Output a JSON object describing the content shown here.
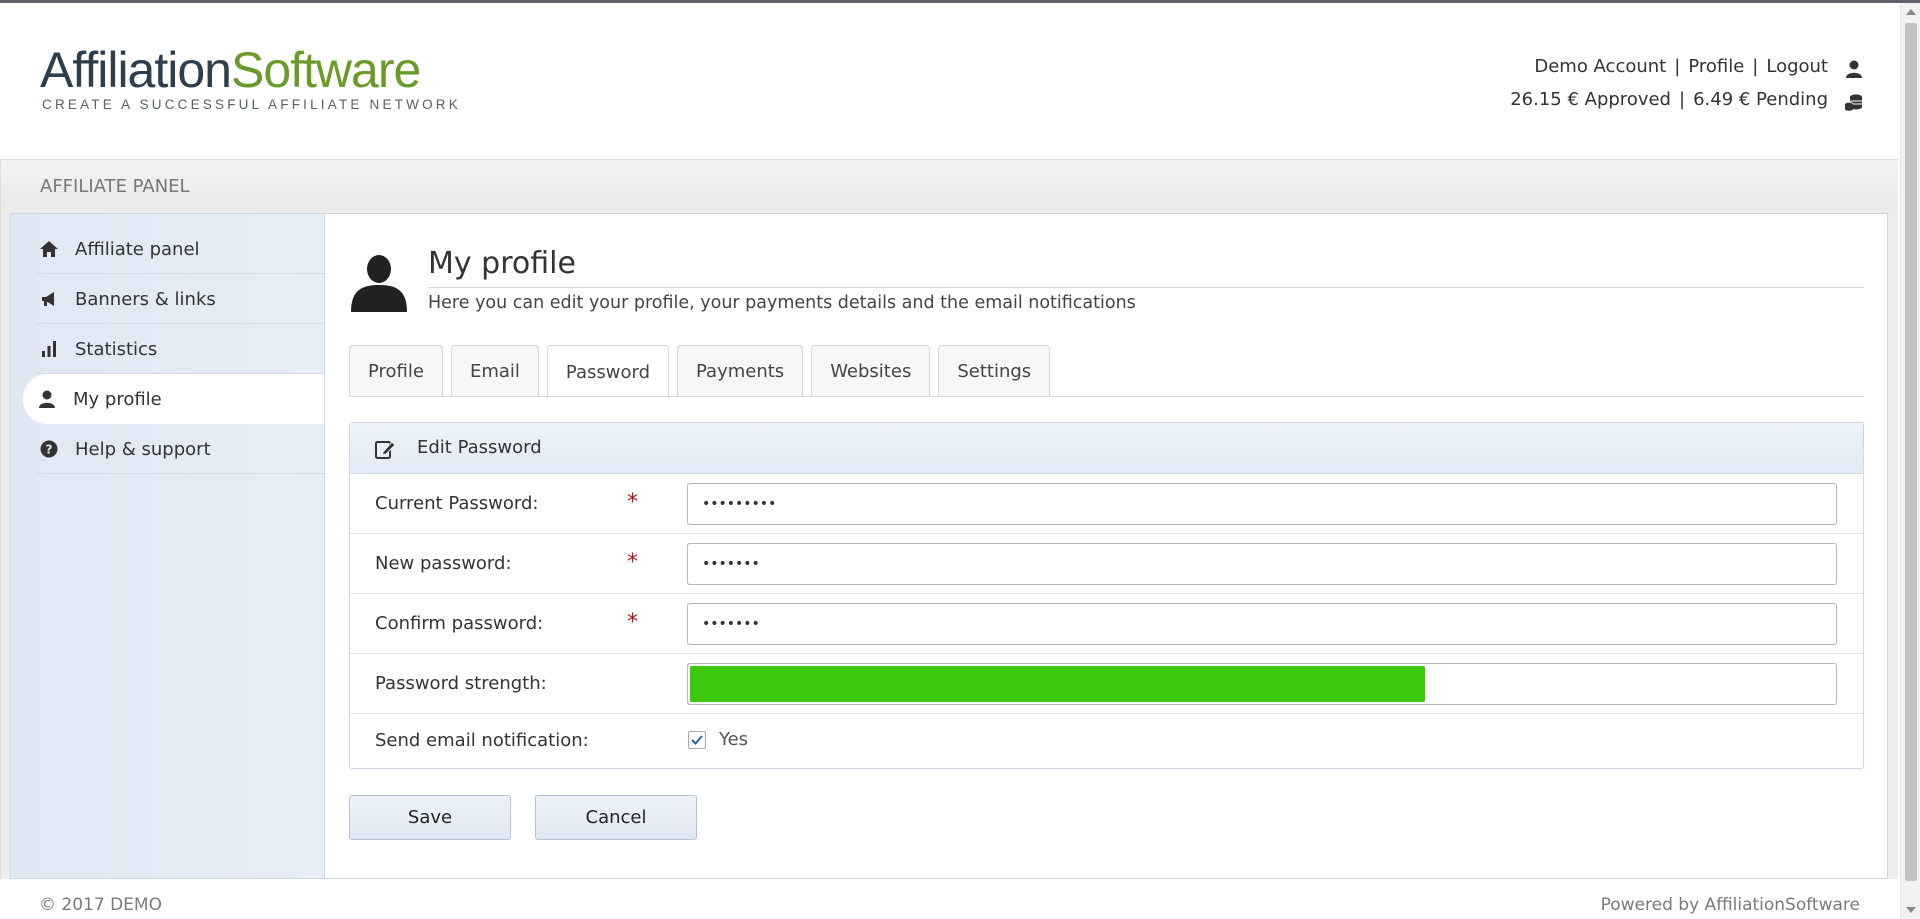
{
  "header": {
    "logo_part1": "Affiliation",
    "logo_part2": "Software",
    "tagline": "CREATE A SUCCESSFUL AFFILIATE NETWORK",
    "account_name": "Demo Account",
    "profile_link": "Profile",
    "logout_link": "Logout",
    "separator": "|",
    "approved": "26.15 € Approved",
    "pending": "6.49 € Pending"
  },
  "panel_bar": {
    "title": "AFFILIATE PANEL"
  },
  "sidebar": {
    "items": [
      {
        "label": "Affiliate panel",
        "icon": "home-icon"
      },
      {
        "label": "Banners & links",
        "icon": "megaphone-icon"
      },
      {
        "label": "Statistics",
        "icon": "bar-chart-icon"
      },
      {
        "label": "My profile",
        "icon": "user-icon",
        "active": true
      },
      {
        "label": "Help & support",
        "icon": "question-icon"
      }
    ]
  },
  "page": {
    "title": "My profile",
    "subtitle": "Here you can edit your profile, your payments details and the email notifications"
  },
  "tabs": [
    {
      "label": "Profile"
    },
    {
      "label": "Email"
    },
    {
      "label": "Password",
      "active": true
    },
    {
      "label": "Payments"
    },
    {
      "label": "Websites"
    },
    {
      "label": "Settings"
    }
  ],
  "form": {
    "heading": "Edit Password",
    "required_mark": "*",
    "current_password": {
      "label": "Current Password:",
      "value": "•••••••••"
    },
    "new_password": {
      "label": "New password:",
      "value": "•••••••"
    },
    "confirm_password": {
      "label": "Confirm password:",
      "value": "•••••••"
    },
    "strength": {
      "label": "Password strength:",
      "percent": 64,
      "color": "#3cc80c"
    },
    "notification": {
      "label": "Send email notification:",
      "checked": true,
      "option": "Yes"
    }
  },
  "buttons": {
    "save": "Save",
    "cancel": "Cancel"
  },
  "footer": {
    "copyright": "© 2017 DEMO",
    "powered": "Powered by AffiliationSoftware"
  },
  "colors": {
    "brand_dark": "#2d3e4c",
    "brand_green": "#6a9a2a",
    "required": "#a81c1c"
  }
}
